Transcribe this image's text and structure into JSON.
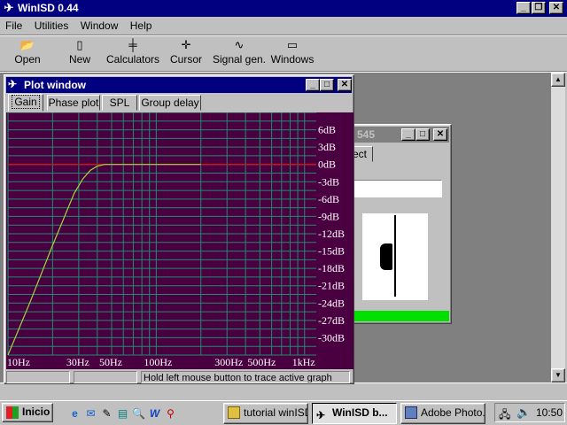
{
  "app": {
    "title": "WinISD 0.44",
    "menu": [
      "File",
      "Utilities",
      "Window",
      "Help"
    ],
    "toolbar": [
      {
        "label": "Open",
        "icon": "open-folder-icon"
      },
      {
        "label": "New",
        "icon": "new-document-icon"
      },
      {
        "label": "Calculators",
        "icon": "calculator-icon"
      },
      {
        "label": "Cursor",
        "icon": "cursor-icon"
      },
      {
        "label": "Signal gen.",
        "icon": "signal-generator-icon"
      },
      {
        "label": "Windows",
        "icon": "windows-icon"
      }
    ]
  },
  "plot_window": {
    "title": "Plot window",
    "tabs": [
      "Gain",
      "Phase plot",
      "SPL",
      "Group delay"
    ],
    "active_tab": "Gain",
    "status": "Hold left mouse button to trace active graph",
    "colors": {
      "background": "#4a0040",
      "grid": "#1e8c6e",
      "reference": "#e01010",
      "curve": "#9adc3c",
      "labels": "#ffffff"
    }
  },
  "project_window": {
    "title_fragment": "545",
    "tab_fragment": "ect",
    "progress_color": "#00e000"
  },
  "chart_data": {
    "type": "line",
    "xscale": "log",
    "xlim": [
      10,
      1200
    ],
    "ylim": [
      -33,
      9
    ],
    "x_ticks": [
      "10Hz",
      "30Hz",
      "50Hz",
      "100Hz",
      "300Hz",
      "500Hz",
      "1kHz"
    ],
    "y_ticks": [
      "6dB",
      "3dB",
      "0dB",
      "-3dB",
      "-6dB",
      "-9dB",
      "-12dB",
      "-15dB",
      "-18dB",
      "-21dB",
      "-24dB",
      "-27dB",
      "-30dB"
    ],
    "series": [
      {
        "x": [
          10,
          14,
          20,
          25,
          28,
          32,
          36,
          40,
          45,
          50,
          60,
          80,
          150,
          200
        ],
        "y": [
          -33,
          -24,
          -14,
          -8,
          -5,
          -2.5,
          -1,
          -0.3,
          0,
          0,
          0,
          0,
          0,
          0
        ]
      }
    ],
    "reference_line_db": 0,
    "grid": true
  },
  "taskbar": {
    "start": "Inicio",
    "tasks": [
      {
        "label": "tutorial winISD",
        "icon": "folder-icon"
      },
      {
        "label": "WinISD b...",
        "icon": "winisd-icon",
        "active": true
      },
      {
        "label": "Adobe Photo...",
        "icon": "photoshop-icon"
      }
    ],
    "clock": "10:50"
  }
}
